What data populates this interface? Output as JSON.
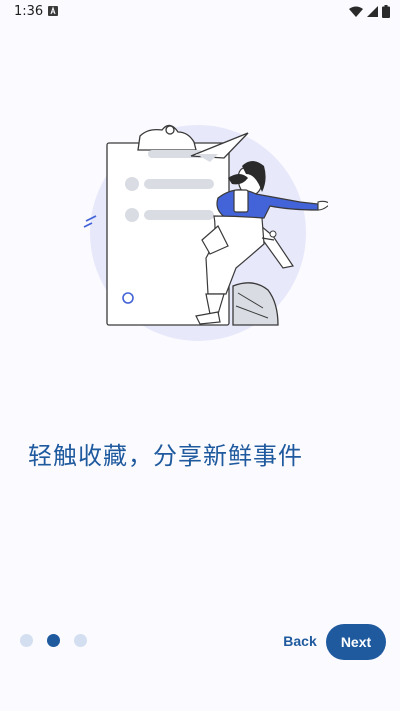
{
  "status_bar": {
    "time": "1:36",
    "icons": [
      "a-notification-icon",
      "wifi-icon",
      "signal-icon",
      "battery-icon"
    ]
  },
  "onboarding": {
    "headline": "轻触收藏，分享新鲜事件",
    "page_count": 3,
    "current_page": 2,
    "back_label": "Back",
    "next_label": "Next"
  },
  "colors": {
    "accent": "#1f5a9e",
    "dot_inactive": "#d3dff0",
    "background": "#fafaff",
    "illustration_blue": "#4363d8",
    "illustration_circle": "#e8e8fb"
  }
}
